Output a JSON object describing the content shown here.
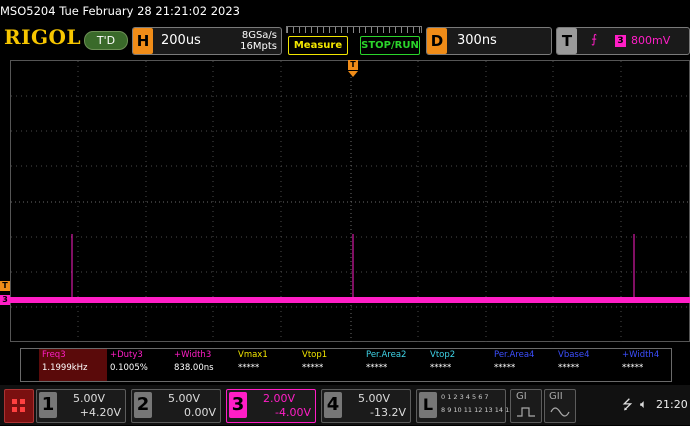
{
  "title": "MSO5204  Tue February 28 21:21:02 2023",
  "brand": "RIGOL",
  "mode_badge": "T'D",
  "horizontal": {
    "letter": "H",
    "timebase": "200us",
    "sample_rate": "8GSa/s",
    "memory_depth": "16Mpts"
  },
  "buttons": {
    "measure": "Measure",
    "stop_run": "STOP/RUN"
  },
  "delay": {
    "letter": "D",
    "value": "300ns"
  },
  "trigger": {
    "letter": "T",
    "edge_symbol": "⨍",
    "source": "3",
    "level": "800mV"
  },
  "markers": {
    "trigger_pos": "T",
    "level_marker": "T",
    "ch3_marker": "3"
  },
  "measurements": [
    {
      "name": "Freq3",
      "value": "1.1999kHz",
      "color": "#ff1ec6",
      "highlight": true
    },
    {
      "name": "+Duty3",
      "value": "0.1005%",
      "color": "#ff1ec6",
      "highlight": false
    },
    {
      "name": "+Width3",
      "value": "838.00ns",
      "color": "#ff1ec6",
      "highlight": false
    },
    {
      "name": "Vmax1",
      "value": "*****",
      "color": "#f2e600",
      "highlight": false
    },
    {
      "name": "Vtop1",
      "value": "*****",
      "color": "#f2e600",
      "highlight": false
    },
    {
      "name": "Per.Area2",
      "value": "*****",
      "color": "#3fd4e8",
      "highlight": false
    },
    {
      "name": "Vtop2",
      "value": "*****",
      "color": "#3fd4e8",
      "highlight": false
    },
    {
      "name": "Per.Area4",
      "value": "*****",
      "color": "#3c4fff",
      "highlight": false
    },
    {
      "name": "Vbase4",
      "value": "*****",
      "color": "#3c4fff",
      "highlight": false
    },
    {
      "name": "+Width4",
      "value": "*****",
      "color": "#3c4fff",
      "highlight": false
    }
  ],
  "channels": [
    {
      "num": "1",
      "scale": "5.00V",
      "offset": "+4.20V",
      "active": false
    },
    {
      "num": "2",
      "scale": "5.00V",
      "offset": "0.00V",
      "active": false
    },
    {
      "num": "3",
      "scale": "2.00V",
      "offset": "-4.00V",
      "active": true
    },
    {
      "num": "4",
      "scale": "5.00V",
      "offset": "-13.2V",
      "active": false
    }
  ],
  "logic": {
    "letter": "L",
    "row1": "0 1 2 3 4 5 6 7",
    "row2": "8 9 10 11 12 13 14 15"
  },
  "gen": {
    "g1": "GI",
    "g2": "GII"
  },
  "status": {
    "clock": "21:20"
  },
  "colors": {
    "ch3": "#ff1ec6",
    "accent_orange": "#f08c18",
    "measure_yellow": "#f2e600",
    "stoprun_green": "#2bd42b"
  }
}
